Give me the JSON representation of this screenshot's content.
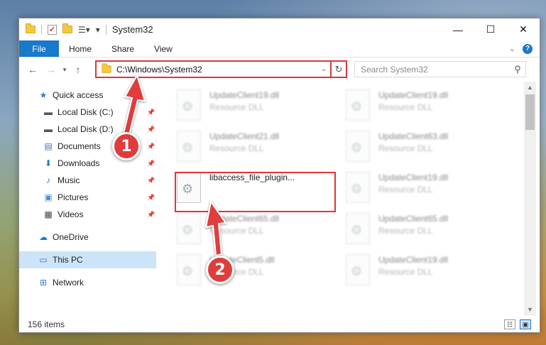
{
  "window": {
    "title": "System32",
    "min_icon": "—",
    "max_icon": "☐",
    "close_icon": "✕"
  },
  "ribbon": {
    "tabs": [
      "File",
      "Home",
      "Share",
      "View"
    ],
    "help": "?"
  },
  "nav": {
    "back": "←",
    "forward": "→",
    "recent": "▾",
    "up": "↑",
    "address": "C:\\Windows\\System32",
    "search_placeholder": "Search System32"
  },
  "sidebar": {
    "items": [
      {
        "label": "Quick access",
        "icon": "star-icon",
        "glyph": "★",
        "color": "#2f7bd6"
      },
      {
        "label": "Local Disk (C:)",
        "icon": "drive-icon",
        "glyph": "▬",
        "color": "#555555",
        "pinned": true
      },
      {
        "label": "Local Disk (D:)",
        "icon": "drive-icon",
        "glyph": "▬",
        "color": "#555555",
        "pinned": true
      },
      {
        "label": "Documents",
        "icon": "documents-icon",
        "glyph": "▤",
        "color": "#4a6fa5",
        "pinned": true
      },
      {
        "label": "Downloads",
        "icon": "downloads-icon",
        "glyph": "⬇",
        "color": "#1979ca",
        "pinned": true
      },
      {
        "label": "Music",
        "icon": "music-icon",
        "glyph": "♪",
        "color": "#1979ca",
        "pinned": true
      },
      {
        "label": "Pictures",
        "icon": "pictures-icon",
        "glyph": "▣",
        "color": "#4a8fcf",
        "pinned": true
      },
      {
        "label": "Videos",
        "icon": "videos-icon",
        "glyph": "▦",
        "color": "#444444",
        "pinned": true
      },
      {
        "label": "OneDrive",
        "icon": "cloud-icon",
        "glyph": "☁",
        "color": "#1979ca"
      },
      {
        "label": "This PC",
        "icon": "computer-icon",
        "glyph": "▭",
        "color": "#3a7bc8"
      },
      {
        "label": "Network",
        "icon": "network-icon",
        "glyph": "⊞",
        "color": "#3a7bc8"
      }
    ]
  },
  "files": [
    {
      "name": "UpdateClient19.dll",
      "type": "Resource DLL"
    },
    {
      "name": "UpdateClient19.dll",
      "type": "Resource DLL"
    },
    {
      "name": "UpdateClient21.dll",
      "type": "Resource DLL"
    },
    {
      "name": "UpdateClient63.dll",
      "type": "Resource DLL"
    },
    {
      "name": "libaccess_file_plugin...",
      "type": ""
    },
    {
      "name": "UpdateClient19.dll",
      "type": "Resource DLL"
    },
    {
      "name": "UpdateClient65.dll",
      "type": "Resource DLL"
    },
    {
      "name": "UpdateClient65.dll",
      "type": "Resource DLL"
    },
    {
      "name": "UpdateClient5.dll",
      "type": "Resource DLL"
    },
    {
      "name": "UpdateClient19.dll",
      "type": "Resource DLL"
    }
  ],
  "status": {
    "items_count": "156 items"
  },
  "annotations": {
    "step1": "1",
    "step2": "2",
    "color": "#e13c3c"
  }
}
